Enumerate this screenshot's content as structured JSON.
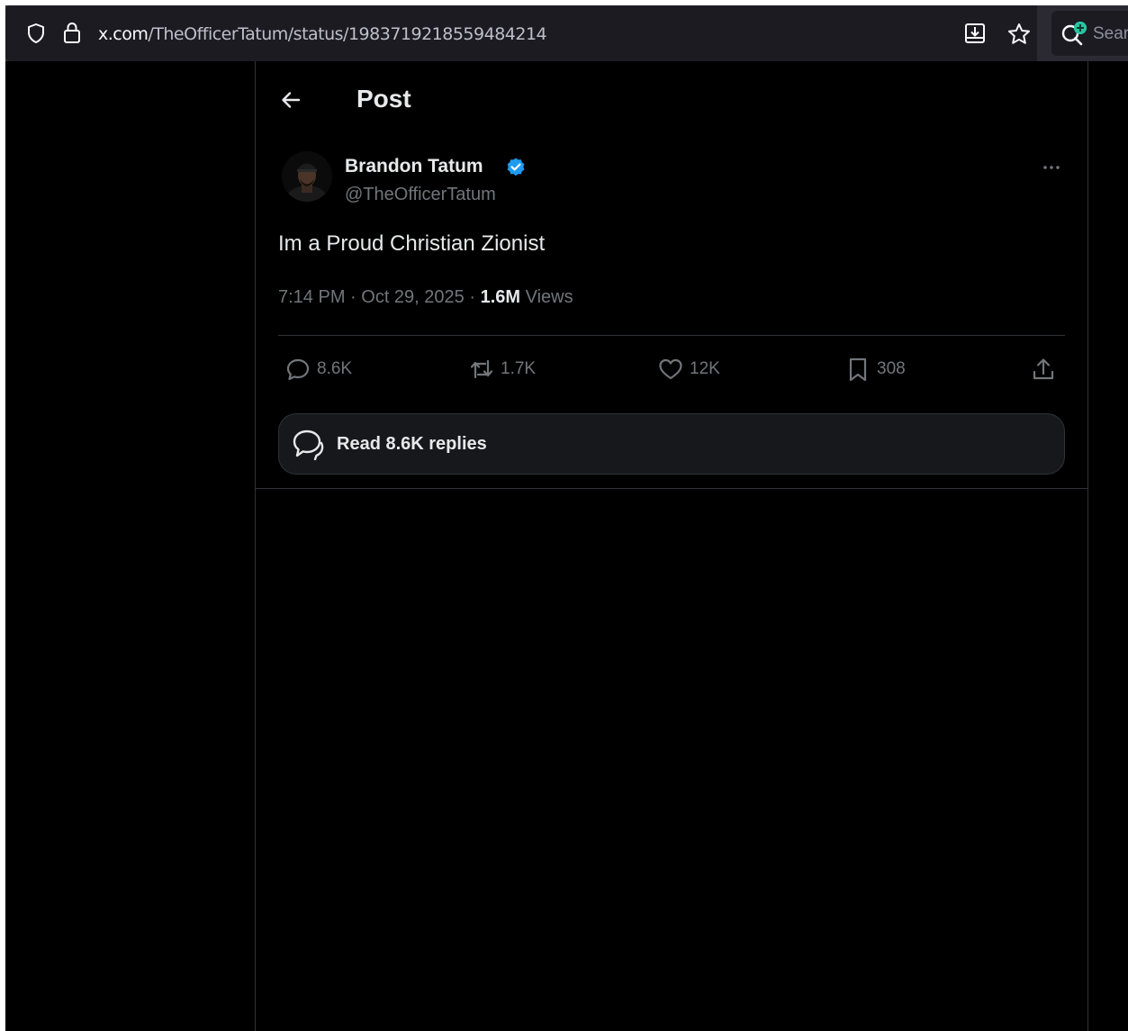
{
  "browser": {
    "url_host": "x.com",
    "url_path": "/TheOfficerTatum/status/1983719218559484214",
    "search_placeholder": "Sear"
  },
  "header": {
    "title": "Post"
  },
  "post": {
    "author_name": "Brandon Tatum",
    "author_handle": "@TheOfficerTatum",
    "text": "Im a Proud Christian Zionist",
    "time": "7:14 PM",
    "date": "Oct 29, 2025",
    "views_count": "1.6M",
    "views_label": "Views",
    "verified_color": "#1d9bf0"
  },
  "actions": {
    "replies": "8.6K",
    "reposts": "1.7K",
    "likes": "12K",
    "bookmarks": "308"
  },
  "read_replies_label": "Read 8.6K replies",
  "colors": {
    "background": "#000000",
    "text_primary": "#e7e9ea",
    "text_secondary": "#71767b",
    "border": "#2f3336"
  }
}
